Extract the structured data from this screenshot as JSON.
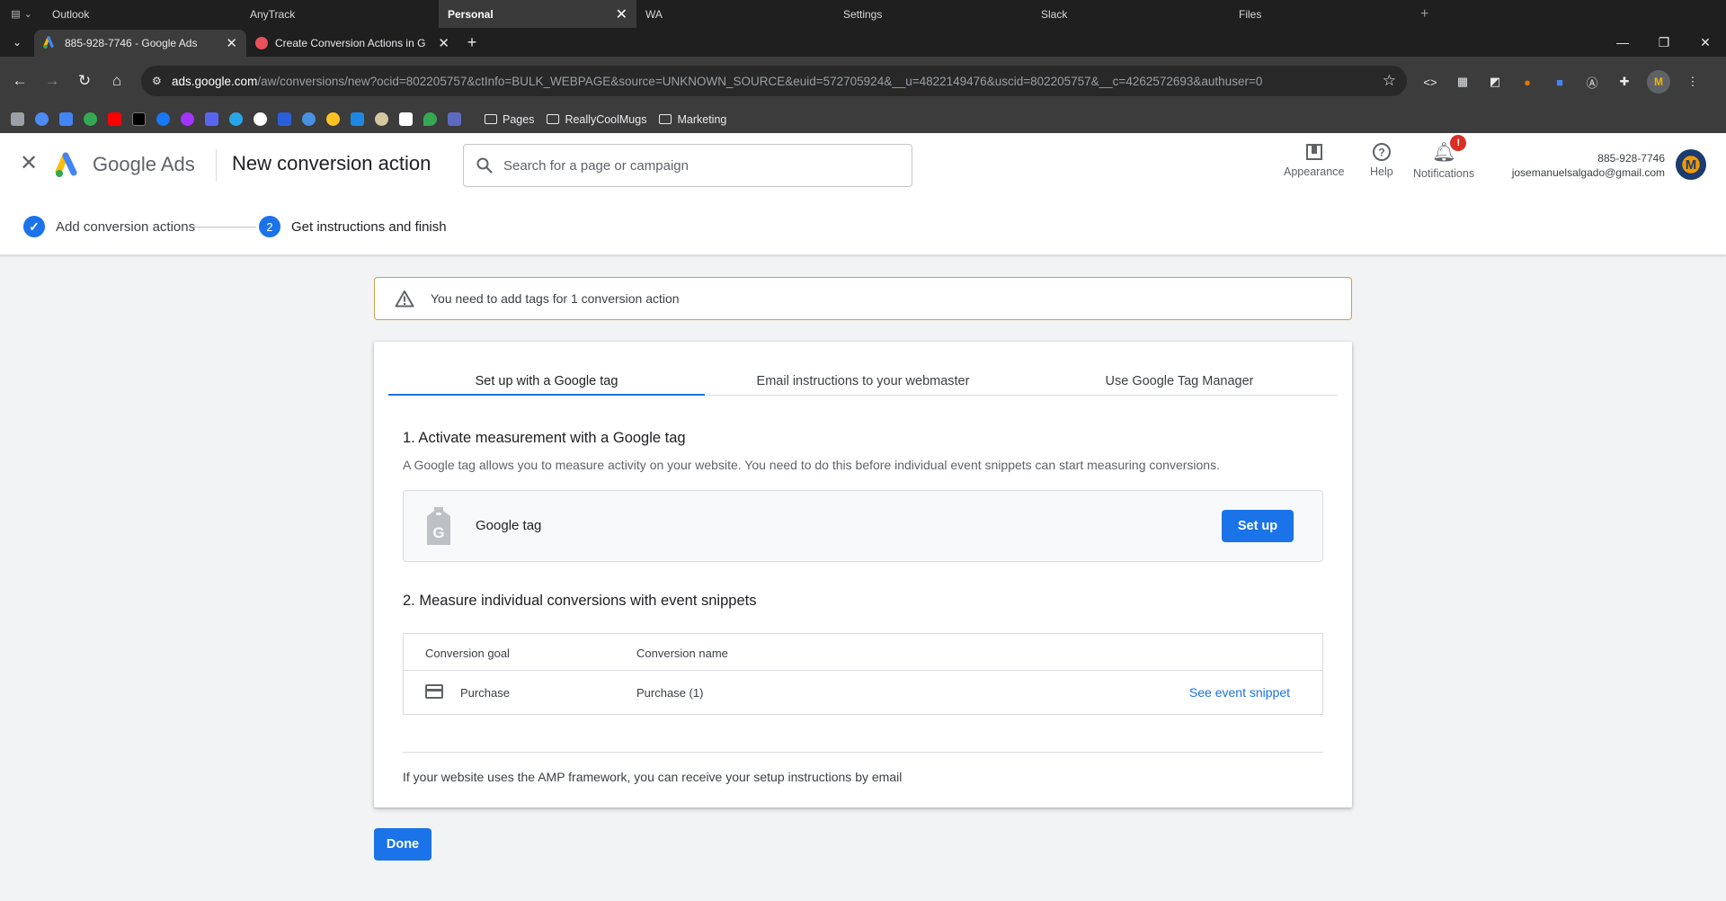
{
  "os_tabs": {
    "items": [
      {
        "label": "Outlook"
      },
      {
        "label": "AnyTrack"
      },
      {
        "label": "Personal",
        "active": true,
        "close": "✕"
      },
      {
        "label": "WA"
      },
      {
        "label": "Settings"
      },
      {
        "label": "Slack"
      },
      {
        "label": "Files"
      }
    ],
    "new_tab": "+"
  },
  "browser_tabs": {
    "tab1_title": "885-928-7746 - Google Ads",
    "tab2_title": "Create Conversion Actions in G",
    "new_tab": "+"
  },
  "address_bar": {
    "host": "ads.google.com",
    "path": "/aw/conversions/new?ocid=802205757&ctInfo=BULK_WEBPAGE&source=UNKNOWN_SOURCE&euid=572705924&__u=4822149476&uscid=802205757&__c=4262572693&authuser=0"
  },
  "bookmarks": {
    "folder1": "Pages",
    "folder2": "ReallyCoolMugs",
    "folder3": "Marketing"
  },
  "header": {
    "brand": "Google Ads",
    "page_title": "New conversion action",
    "search_placeholder": "Search for a page or campaign",
    "appearance_label": "Appearance",
    "help_label": "Help",
    "notifications_label": "Notifications",
    "notifications_badge": "!",
    "account_id": "885-928-7746",
    "account_email": "josemanuelsalgado@gmail.com",
    "avatar_letter": "M"
  },
  "stepper": {
    "step1_label": "Add conversion actions",
    "step2_number": "2",
    "step2_label": "Get instructions and finish"
  },
  "alert": {
    "text": "You need to add tags for 1 conversion action"
  },
  "tabs": {
    "tab1": "Set up with a Google tag",
    "tab2": "Email instructions to your webmaster",
    "tab3": "Use Google Tag Manager"
  },
  "section1": {
    "title": "1. Activate measurement with a Google tag",
    "description": "A Google tag allows you to measure activity on your website. You need to do this before individual event snippets can start measuring conversions.",
    "tag_label": "Google tag",
    "setup_button": "Set up"
  },
  "section2": {
    "title": "2. Measure individual conversions with event snippets",
    "col_goal": "Conversion goal",
    "col_name": "Conversion name",
    "rows": [
      {
        "goal": "Purchase",
        "name": "Purchase (1)",
        "action": "See event snippet"
      }
    ]
  },
  "amp_note": "If your website uses the AMP framework, you can receive your setup instructions by email",
  "done_button": "Done",
  "colors": {
    "accent": "#1a73e8",
    "warning_border": "#c6a34a",
    "badge": "#d93025"
  }
}
